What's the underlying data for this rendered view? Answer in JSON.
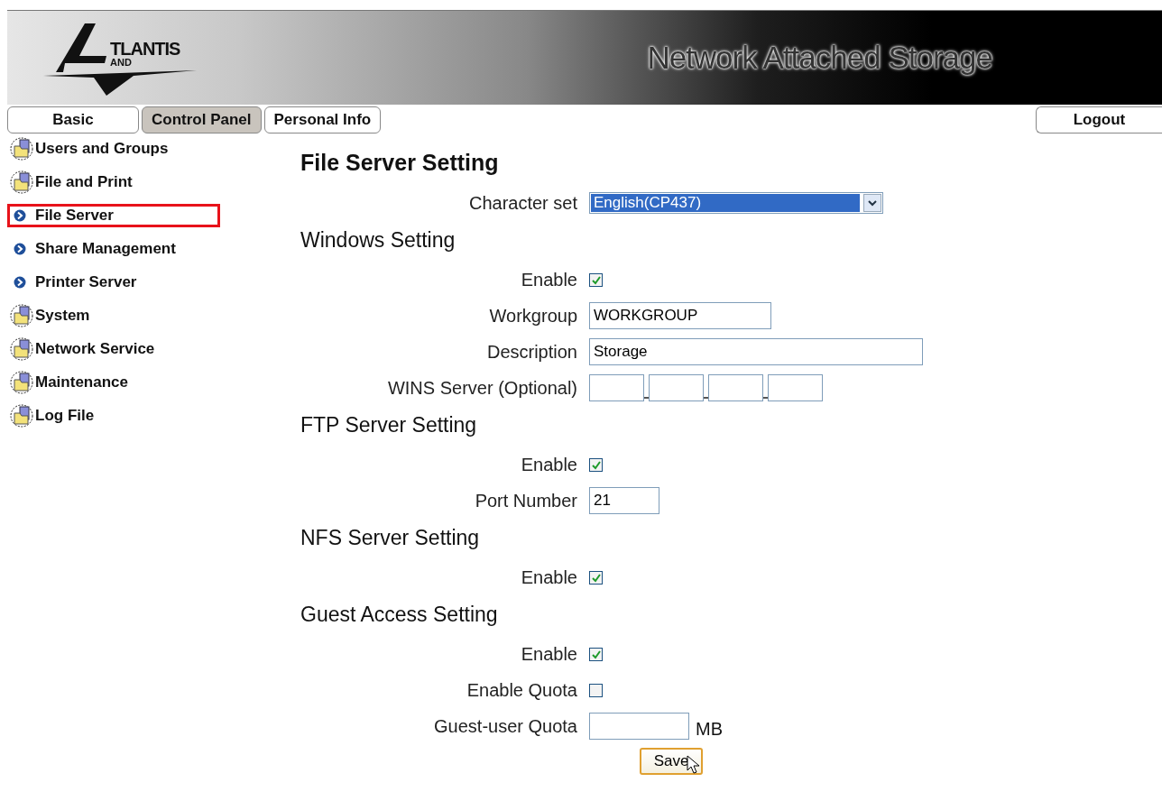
{
  "header": {
    "logo_text": "TLANTIS",
    "logo_subtext": "AND",
    "title": "Network Attached Storage"
  },
  "tabs": [
    {
      "label": "Basic",
      "selected": false
    },
    {
      "label": "Control Panel",
      "selected": true
    },
    {
      "label": "Personal Info",
      "selected": false
    }
  ],
  "logout": "Logout",
  "sidebar": {
    "items": [
      {
        "label": "Users and Groups",
        "kind": "folder",
        "selected": false
      },
      {
        "label": "File and Print",
        "kind": "folder",
        "selected": false
      },
      {
        "label": "File Server",
        "kind": "sub",
        "selected": true
      },
      {
        "label": "Share Management",
        "kind": "sub",
        "selected": false
      },
      {
        "label": "Printer Server",
        "kind": "sub",
        "selected": false
      },
      {
        "label": "System",
        "kind": "folder",
        "selected": false
      },
      {
        "label": "Network Service",
        "kind": "folder",
        "selected": false
      },
      {
        "label": "Maintenance",
        "kind": "folder",
        "selected": false
      },
      {
        "label": "Log File",
        "kind": "folder",
        "selected": false
      }
    ]
  },
  "page_title": "File Server Setting",
  "sections": [
    {
      "rows": [
        {
          "kind": "select",
          "label": "Character set",
          "value": "English(CP437)"
        }
      ]
    },
    {
      "title": "Windows Setting",
      "rows": [
        {
          "kind": "checkbox",
          "label": "Enable",
          "checked": true
        },
        {
          "kind": "medium_text",
          "label": "Workgroup",
          "value": "WORKGROUP"
        },
        {
          "kind": "long_text",
          "label": "Description",
          "value": "Storage"
        },
        {
          "kind": "ip",
          "label": "WINS Server (Optional)"
        }
      ]
    },
    {
      "title": "FTP Server Setting",
      "rows": [
        {
          "kind": "checkbox",
          "label": "Enable",
          "checked": true
        },
        {
          "kind": "short_text",
          "label": "Port Number",
          "value": "21"
        }
      ]
    },
    {
      "title": "NFS Server Setting",
      "rows": [
        {
          "kind": "checkbox",
          "label": "Enable",
          "checked": true
        }
      ]
    },
    {
      "title": "Guest Access Setting",
      "rows": [
        {
          "kind": "checkbox",
          "label": "Enable",
          "checked": true
        },
        {
          "kind": "checkbox",
          "label": "Enable Quota",
          "checked": false
        },
        {
          "kind": "quota_text",
          "label": "Guest-user Quota",
          "unit": "MB"
        }
      ]
    }
  ],
  "save_button": "Save"
}
